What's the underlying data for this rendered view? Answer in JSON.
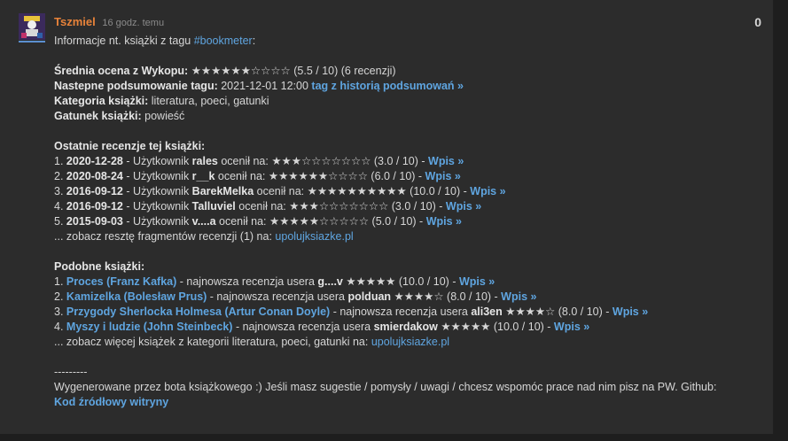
{
  "post": {
    "author": "Tszmiel",
    "time": "16 godz. temu",
    "score": "0",
    "intro_text": "Informacje nt. książki z tagu ",
    "intro_tag": "#bookmeter",
    "intro_colon": ":",
    "avg_label": "Średnia ocena z Wykopu:",
    "avg_stars": "★★★★★★☆☆☆☆",
    "avg_value": "(5.5 / 10) (6 recenzji)",
    "next_label": "Nastepne podsumowanie tagu:",
    "next_value": "2021-12-01 12:00",
    "next_link": "tag z historią podsumowań »",
    "category_label": "Kategoria książki:",
    "category_value": "literatura, poeci, gatunki",
    "genre_label": "Gatunek książki:",
    "genre_value": "powieść",
    "recent_header": "Ostatnie recenzje tej książki:",
    "reviews": [
      {
        "num": "1.",
        "date": "2020-12-28",
        "pre": " - Użytkownik ",
        "user": "rales",
        "mid": " ocenił na: ",
        "stars": "★★★☆☆☆☆☆☆☆",
        "score": " (3.0 / 10) - ",
        "link": "Wpis »"
      },
      {
        "num": "2.",
        "date": "2020-08-24",
        "pre": " - Użytkownik ",
        "user": "r__k",
        "mid": " ocenił na: ",
        "stars": "★★★★★★☆☆☆☆",
        "score": " (6.0 / 10) - ",
        "link": "Wpis »"
      },
      {
        "num": "3.",
        "date": "2016-09-12",
        "pre": " - Użytkownik ",
        "user": "BarekMelka",
        "mid": " ocenił na: ",
        "stars": "★★★★★★★★★★",
        "score": " (10.0 / 10) - ",
        "link": "Wpis »"
      },
      {
        "num": "4.",
        "date": "2016-09-12",
        "pre": " - Użytkownik ",
        "user": "Talluviel",
        "mid": " ocenił na: ",
        "stars": "★★★☆☆☆☆☆☆☆",
        "score": " (3.0 / 10) - ",
        "link": "Wpis »"
      },
      {
        "num": "5.",
        "date": "2015-09-03",
        "pre": " - Użytkownik ",
        "user": "v....a",
        "mid": " ocenił na: ",
        "stars": "★★★★★☆☆☆☆☆",
        "score": " (5.0 / 10) - ",
        "link": "Wpis »"
      }
    ],
    "more_reviews_text": "... zobacz resztę fragmentów recenzji (1) na: ",
    "more_reviews_link": "upolujksiazke.pl",
    "similar_header": "Podobne książki:",
    "similar": [
      {
        "num": "1.",
        "title": "Proces (Franz Kafka)",
        "pre": " - najnowsza recenzja usera ",
        "user": "g....v",
        "stars": "★★★★★",
        "score": " (10.0 / 10) - ",
        "link": "Wpis »"
      },
      {
        "num": "2.",
        "title": "Kamizelka (Bolesław Prus)",
        "pre": " - najnowsza recenzja usera ",
        "user": "polduan",
        "stars": "★★★★☆",
        "score": " (8.0 / 10) - ",
        "link": "Wpis »"
      },
      {
        "num": "3.",
        "title": "Przygody Sherlocka Holmesa (Artur Conan Doyle)",
        "pre": " - najnowsza recenzja usera ",
        "user": "ali3en",
        "stars": "★★★★☆",
        "score": " (8.0 / 10) - ",
        "link": "Wpis »"
      },
      {
        "num": "4.",
        "title": "Myszy i ludzie (John Steinbeck)",
        "pre": " - najnowsza recenzja usera ",
        "user": "smierdakow",
        "stars": "★★★★★",
        "score": " (10.0 / 10) - ",
        "link": "Wpis »"
      }
    ],
    "more_similar_text": "... zobacz więcej książek z kategorii literatura, poeci, gatunki na: ",
    "more_similar_link": "upolujksiazke.pl",
    "separator": "---------",
    "footer_text": "Wygenerowane przez bota książkowego :) Jeśli masz sugestie / pomysły / uwagi / chcesz wspomóc prace nad nim pisz na PW. Github:",
    "footer_link": "Kod źródłowy witryny"
  }
}
